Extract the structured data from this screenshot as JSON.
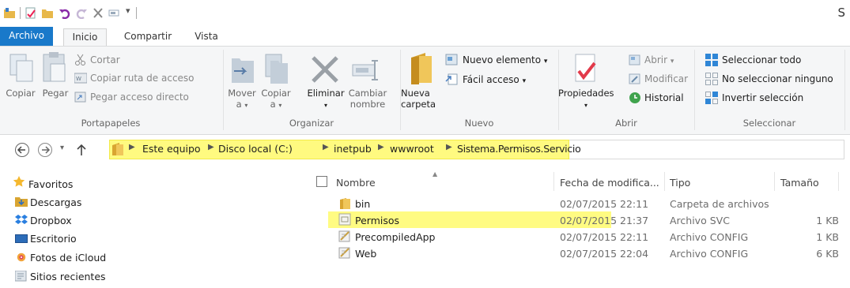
{
  "window": {
    "title_fragment": "S"
  },
  "tabs": [
    {
      "label": "Archivo"
    },
    {
      "label": "Inicio"
    },
    {
      "label": "Compartir"
    },
    {
      "label": "Vista"
    }
  ],
  "ribbon": {
    "portapapeles": {
      "group": "Portapapeles",
      "copiar": "Copiar",
      "pegar": "Pegar",
      "cortar": "Cortar",
      "copiar_ruta": "Copiar ruta de acceso",
      "pegar_acceso": "Pegar acceso directo"
    },
    "organizar": {
      "group": "Organizar",
      "mover_1": "Mover",
      "mover_2": "a",
      "copiar_1": "Copiar",
      "copiar_2": "a",
      "eliminar": "Eliminar",
      "cambiar_1": "Cambiar",
      "cambiar_2": "nombre"
    },
    "nuevo": {
      "group": "Nuevo",
      "nueva_1": "Nueva",
      "nueva_2": "carpeta",
      "nuevo_elemento": "Nuevo elemento",
      "facil_acceso": "Fácil acceso"
    },
    "abrir": {
      "group": "Abrir",
      "propiedades": "Propiedades",
      "abrir": "Abrir",
      "modificar": "Modificar",
      "historial": "Historial"
    },
    "seleccionar": {
      "group": "Seleccionar",
      "todo": "Seleccionar todo",
      "ninguno": "No seleccionar ninguno",
      "invertir": "Invertir selección"
    }
  },
  "address": {
    "crumbs": [
      "Este equipo",
      "Disco local (C:)",
      "inetpub",
      "wwwroot",
      "Sistema.Permisos.Servicio"
    ]
  },
  "nav_pane": {
    "items": [
      {
        "label": "Favoritos",
        "icon": "star-icon"
      },
      {
        "label": "Descargas",
        "icon": "downloads-folder-icon"
      },
      {
        "label": "Dropbox",
        "icon": "dropbox-icon"
      },
      {
        "label": "Escritorio",
        "icon": "desktop-icon"
      },
      {
        "label": "Fotos de iCloud",
        "icon": "icloud-photos-icon"
      },
      {
        "label": "Sitios recientes",
        "icon": "recent-places-icon"
      }
    ]
  },
  "file_list": {
    "columns": {
      "name": "Nombre",
      "date": "Fecha de modifica...",
      "type": "Tipo",
      "size": "Tamaño"
    },
    "rows": [
      {
        "name": "bin",
        "date": "02/07/2015 22:11",
        "type": "Carpeta de archivos",
        "size": "",
        "icon": "folder-icon",
        "highlighted": false
      },
      {
        "name": "Permisos",
        "date": "02/07/2015 21:37",
        "type": "Archivo SVC",
        "size": "1 KB",
        "icon": "svc-file-icon",
        "highlighted": true
      },
      {
        "name": "PrecompiledApp",
        "date": "02/07/2015 22:11",
        "type": "Archivo CONFIG",
        "size": "1 KB",
        "icon": "config-file-icon",
        "highlighted": false
      },
      {
        "name": "Web",
        "date": "02/07/2015 22:04",
        "type": "Archivo CONFIG",
        "size": "6 KB",
        "icon": "config-file-icon",
        "highlighted": false
      }
    ]
  },
  "colors": {
    "accent": "#1979ca",
    "highlight": "#fffb82"
  }
}
